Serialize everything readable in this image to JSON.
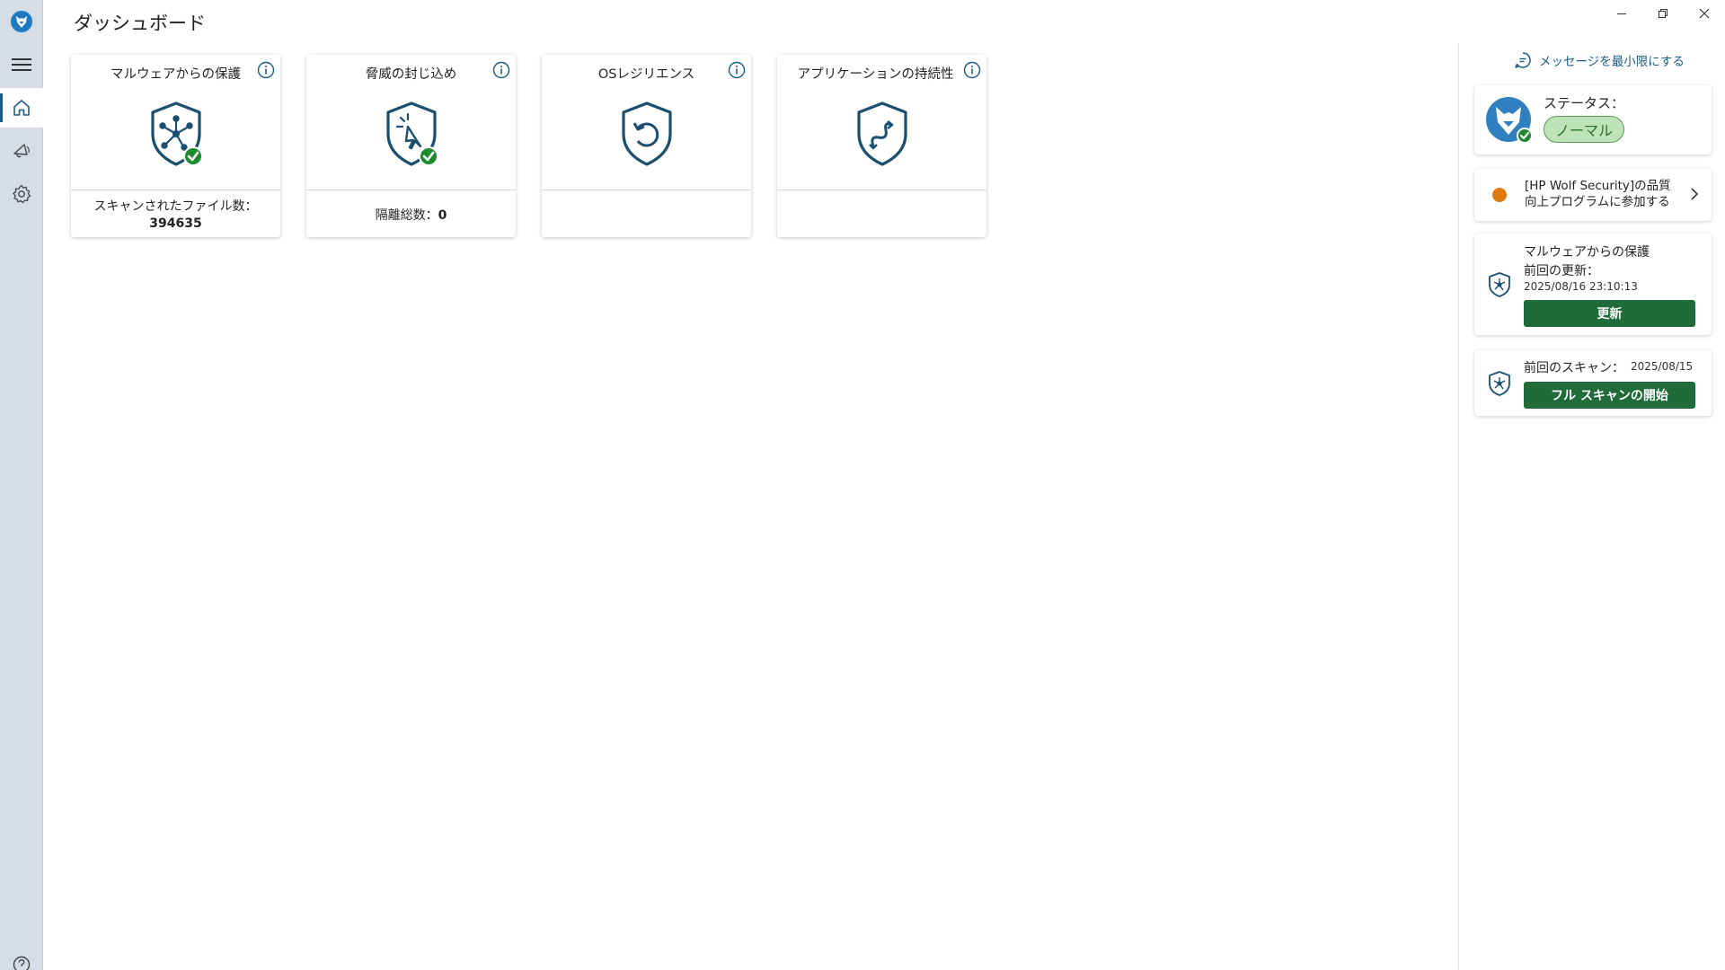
{
  "header": {
    "title": "ダッシュボード"
  },
  "cards": [
    {
      "title": "マルウェアからの保護",
      "footer_label": "スキャンされたファイル数：",
      "footer_value": "394635",
      "status": "ok"
    },
    {
      "title": "脅威の封じ込め",
      "footer_label": "隔離総数：",
      "footer_value": "0",
      "status": "ok"
    },
    {
      "title": "OSレジリエンス",
      "footer_label": "",
      "footer_value": "",
      "status": "none"
    },
    {
      "title": "アプリケーションの持続性",
      "footer_label": "",
      "footer_value": "",
      "status": "none"
    }
  ],
  "right_panel": {
    "minimize_link": "メッセージを最小限にする",
    "status": {
      "label": "ステータス：",
      "value": "ノーマル"
    },
    "promo": {
      "text": "[HP Wolf Security]の品質向上プログラムに参加する"
    },
    "malware": {
      "title": "マルウェアからの保護",
      "last_update_label": "前回の更新：",
      "last_update_value": "2025/08/16 23:10:13",
      "button": "更新"
    },
    "scan": {
      "last_scan_label": "前回のスキャン：",
      "last_scan_value": "2025/08/15",
      "button": "フル スキャンの開始"
    }
  },
  "icons": {
    "rail": [
      "menu-icon",
      "home-icon",
      "notifications-icon",
      "settings-icon",
      "help-icon"
    ],
    "window": [
      "minimize-icon",
      "restore-icon",
      "close-icon"
    ]
  },
  "colors": {
    "accent": "#1b5d86",
    "primary_button": "#1f6b3a",
    "status_ok": "#1e8a2e",
    "status_pill_bg": "#bfe3b8",
    "notice_dot": "#e07a10",
    "rail_bg": "#d6dde6"
  }
}
